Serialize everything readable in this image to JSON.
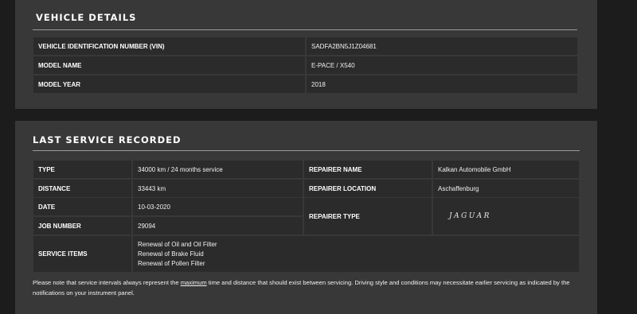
{
  "vehicle_details": {
    "title": "VEHICLE DETAILS",
    "rows": [
      {
        "label": "VEHICLE IDENTIFICATION NUMBER (VIN)",
        "value": "SADFA2BN5J1Z04681"
      },
      {
        "label": "MODEL NAME",
        "value": "E-PACE / X540"
      },
      {
        "label": "MODEL YEAR",
        "value": "2018"
      }
    ]
  },
  "last_service": {
    "title": "LAST SERVICE RECORDED",
    "type_label": "TYPE",
    "type_value": "34000 km / 24 months service",
    "distance_label": "DISTANCE",
    "distance_value": "33443 km",
    "date_label": "DATE",
    "date_value": "10-03-2020",
    "job_label": "JOB NUMBER",
    "job_value": "29094",
    "repairer_name_label": "REPAIRER NAME",
    "repairer_name_value": "Kalkan Automobile GmbH",
    "repairer_location_label": "REPAIRER LOCATION",
    "repairer_location_value": "Aschaffenburg",
    "repairer_type_label": "REPAIRER TYPE",
    "repairer_type_logo": "JAGUAR",
    "service_items_label": "SERVICE ITEMS",
    "service_items": [
      "Renewal of Oil and Oil Filter",
      "Renewal of Brake Fluid",
      "Renewal of Pollen Filter"
    ],
    "note_before": "Please note that service intervals always represent the ",
    "note_emphasis": "maximum",
    "note_after": " time and distance that should exist between servicing. Driving style and conditions may necessitate earlier servicing as indicated by the notifications on your instrument panel."
  }
}
